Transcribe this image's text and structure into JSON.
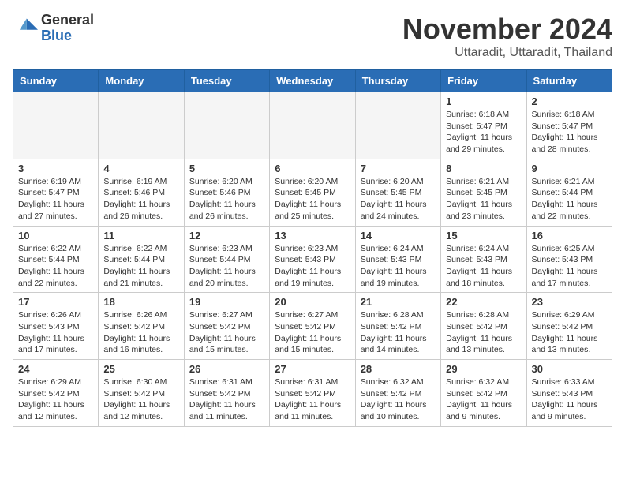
{
  "header": {
    "logo_general": "General",
    "logo_blue": "Blue",
    "month": "November 2024",
    "location": "Uttaradit, Uttaradit, Thailand"
  },
  "weekdays": [
    "Sunday",
    "Monday",
    "Tuesday",
    "Wednesday",
    "Thursday",
    "Friday",
    "Saturday"
  ],
  "weeks": [
    [
      {
        "day": "",
        "info": ""
      },
      {
        "day": "",
        "info": ""
      },
      {
        "day": "",
        "info": ""
      },
      {
        "day": "",
        "info": ""
      },
      {
        "day": "",
        "info": ""
      },
      {
        "day": "1",
        "info": "Sunrise: 6:18 AM\nSunset: 5:47 PM\nDaylight: 11 hours and 29 minutes."
      },
      {
        "day": "2",
        "info": "Sunrise: 6:18 AM\nSunset: 5:47 PM\nDaylight: 11 hours and 28 minutes."
      }
    ],
    [
      {
        "day": "3",
        "info": "Sunrise: 6:19 AM\nSunset: 5:47 PM\nDaylight: 11 hours and 27 minutes."
      },
      {
        "day": "4",
        "info": "Sunrise: 6:19 AM\nSunset: 5:46 PM\nDaylight: 11 hours and 26 minutes."
      },
      {
        "day": "5",
        "info": "Sunrise: 6:20 AM\nSunset: 5:46 PM\nDaylight: 11 hours and 26 minutes."
      },
      {
        "day": "6",
        "info": "Sunrise: 6:20 AM\nSunset: 5:45 PM\nDaylight: 11 hours and 25 minutes."
      },
      {
        "day": "7",
        "info": "Sunrise: 6:20 AM\nSunset: 5:45 PM\nDaylight: 11 hours and 24 minutes."
      },
      {
        "day": "8",
        "info": "Sunrise: 6:21 AM\nSunset: 5:45 PM\nDaylight: 11 hours and 23 minutes."
      },
      {
        "day": "9",
        "info": "Sunrise: 6:21 AM\nSunset: 5:44 PM\nDaylight: 11 hours and 22 minutes."
      }
    ],
    [
      {
        "day": "10",
        "info": "Sunrise: 6:22 AM\nSunset: 5:44 PM\nDaylight: 11 hours and 22 minutes."
      },
      {
        "day": "11",
        "info": "Sunrise: 6:22 AM\nSunset: 5:44 PM\nDaylight: 11 hours and 21 minutes."
      },
      {
        "day": "12",
        "info": "Sunrise: 6:23 AM\nSunset: 5:44 PM\nDaylight: 11 hours and 20 minutes."
      },
      {
        "day": "13",
        "info": "Sunrise: 6:23 AM\nSunset: 5:43 PM\nDaylight: 11 hours and 19 minutes."
      },
      {
        "day": "14",
        "info": "Sunrise: 6:24 AM\nSunset: 5:43 PM\nDaylight: 11 hours and 19 minutes."
      },
      {
        "day": "15",
        "info": "Sunrise: 6:24 AM\nSunset: 5:43 PM\nDaylight: 11 hours and 18 minutes."
      },
      {
        "day": "16",
        "info": "Sunrise: 6:25 AM\nSunset: 5:43 PM\nDaylight: 11 hours and 17 minutes."
      }
    ],
    [
      {
        "day": "17",
        "info": "Sunrise: 6:26 AM\nSunset: 5:43 PM\nDaylight: 11 hours and 17 minutes."
      },
      {
        "day": "18",
        "info": "Sunrise: 6:26 AM\nSunset: 5:42 PM\nDaylight: 11 hours and 16 minutes."
      },
      {
        "day": "19",
        "info": "Sunrise: 6:27 AM\nSunset: 5:42 PM\nDaylight: 11 hours and 15 minutes."
      },
      {
        "day": "20",
        "info": "Sunrise: 6:27 AM\nSunset: 5:42 PM\nDaylight: 11 hours and 15 minutes."
      },
      {
        "day": "21",
        "info": "Sunrise: 6:28 AM\nSunset: 5:42 PM\nDaylight: 11 hours and 14 minutes."
      },
      {
        "day": "22",
        "info": "Sunrise: 6:28 AM\nSunset: 5:42 PM\nDaylight: 11 hours and 13 minutes."
      },
      {
        "day": "23",
        "info": "Sunrise: 6:29 AM\nSunset: 5:42 PM\nDaylight: 11 hours and 13 minutes."
      }
    ],
    [
      {
        "day": "24",
        "info": "Sunrise: 6:29 AM\nSunset: 5:42 PM\nDaylight: 11 hours and 12 minutes."
      },
      {
        "day": "25",
        "info": "Sunrise: 6:30 AM\nSunset: 5:42 PM\nDaylight: 11 hours and 12 minutes."
      },
      {
        "day": "26",
        "info": "Sunrise: 6:31 AM\nSunset: 5:42 PM\nDaylight: 11 hours and 11 minutes."
      },
      {
        "day": "27",
        "info": "Sunrise: 6:31 AM\nSunset: 5:42 PM\nDaylight: 11 hours and 11 minutes."
      },
      {
        "day": "28",
        "info": "Sunrise: 6:32 AM\nSunset: 5:42 PM\nDaylight: 11 hours and 10 minutes."
      },
      {
        "day": "29",
        "info": "Sunrise: 6:32 AM\nSunset: 5:42 PM\nDaylight: 11 hours and 9 minutes."
      },
      {
        "day": "30",
        "info": "Sunrise: 6:33 AM\nSunset: 5:43 PM\nDaylight: 11 hours and 9 minutes."
      }
    ]
  ]
}
